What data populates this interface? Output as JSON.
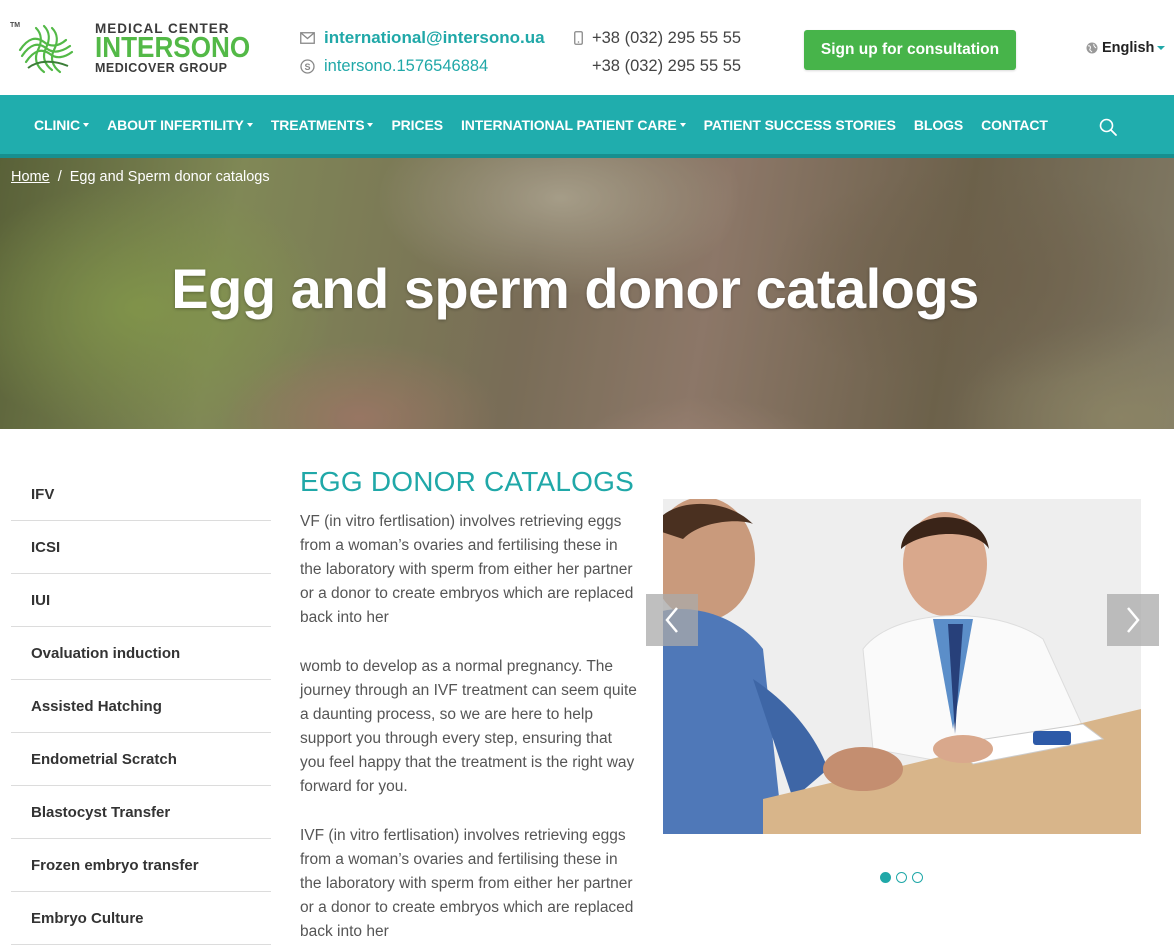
{
  "header": {
    "logo": {
      "tm": "TM",
      "line1": "MEDICAL CENTER",
      "line2": "INTERSONO",
      "line3": "MEDICOVER GROUP"
    },
    "email": "international@intersono.ua",
    "skype": "intersono.1576546884",
    "phones": [
      "+38 (032) 295 55 55",
      "+38 (032) 295 55 55"
    ],
    "cta_label": "Sign up for consultation",
    "language": "English"
  },
  "nav": {
    "items": [
      {
        "label": "CLINIC",
        "dropdown": true
      },
      {
        "label": "ABOUT INFERTILITY",
        "dropdown": true
      },
      {
        "label": "TREATMENTS",
        "dropdown": true
      },
      {
        "label": "PRICES",
        "dropdown": false
      },
      {
        "label": "INTERNATIONAL PATIENT CARE",
        "dropdown": true
      },
      {
        "label": "PATIENT SUCCESS STORIES",
        "dropdown": false
      },
      {
        "label": "BLOGS",
        "dropdown": false
      },
      {
        "label": "CONTACT",
        "dropdown": false
      }
    ]
  },
  "hero": {
    "breadcrumb_home": "Home",
    "breadcrumb_separator": "/",
    "breadcrumb_current": "Egg and Sperm donor catalogs",
    "title": "Egg and sperm donor catalogs"
  },
  "sidebar": {
    "items": [
      "IFV",
      "ICSI",
      "IUI",
      "Ovaluation induction",
      "Assisted Hatching",
      "Endometrial Scratch",
      "Blastocyst Transfer",
      "Frozen embryo transfer",
      "Embryo Culture"
    ]
  },
  "main": {
    "heading": "EGG DONOR CATALOGS",
    "paragraphs": [
      "VF (in vitro fertlisation) involves retrieving eggs from a woman’s ovaries and fertilising these in the laboratory with sperm from either her partner or a donor to create embryos which are replaced back into her",
      "womb to develop as a normal pregnancy. The journey through an IVF treatment can seem quite a daunting process, so we are here to help support you through every step, ensuring that you feel happy that the treatment is the right way forward for you.",
      "IVF (in vitro fertlisation) involves retrieving eggs from a woman’s ovaries and fertilising these in the laboratory with sperm from either her partner or a donor to create embryos which are replaced back into her"
    ]
  },
  "slider": {
    "slide_count": 3,
    "active_index": 0
  },
  "colors": {
    "teal": "#20adad",
    "green": "#47b44a",
    "text": "#333333"
  }
}
